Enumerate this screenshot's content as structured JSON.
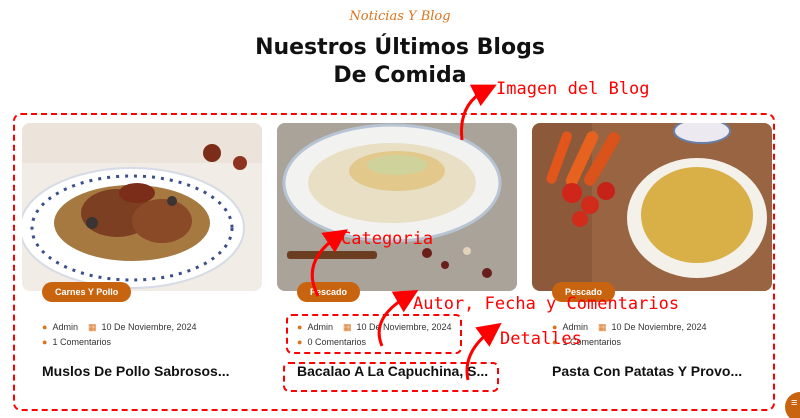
{
  "section": {
    "eyebrow": "Noticias Y Blog",
    "title": "Nuestros Últimos Blogs De Comida"
  },
  "posts": [
    {
      "category": "Carnes Y Pollo",
      "author": "Admin",
      "date": "10 De Noviembre, 2024",
      "comments": "1 Comentarios",
      "title": "Muslos De Pollo Sabrosos..."
    },
    {
      "category": "Pescado",
      "author": "Admin",
      "date": "10 De Noviembre, 2024",
      "comments": "0 Comentarios",
      "title": "Bacalao A La Capuchina, S..."
    },
    {
      "category": "Pescado",
      "author": "Admin",
      "date": "10 De Noviembre, 2024",
      "comments": "1 Comentarios",
      "title": "Pasta Con Patatas Y Provo..."
    }
  ],
  "annotations": {
    "image": "Imagen del Blog",
    "category": "Categoria",
    "meta": "Autor, Fecha y Comentarios",
    "details": "Detalles"
  },
  "icons": {
    "author": "user-icon",
    "date": "calendar-icon",
    "comments": "comments-icon",
    "fab": "chat-icon"
  },
  "colors": {
    "accent": "#d9731c",
    "badge": "#c8630f",
    "annotation": "#ff0000"
  }
}
